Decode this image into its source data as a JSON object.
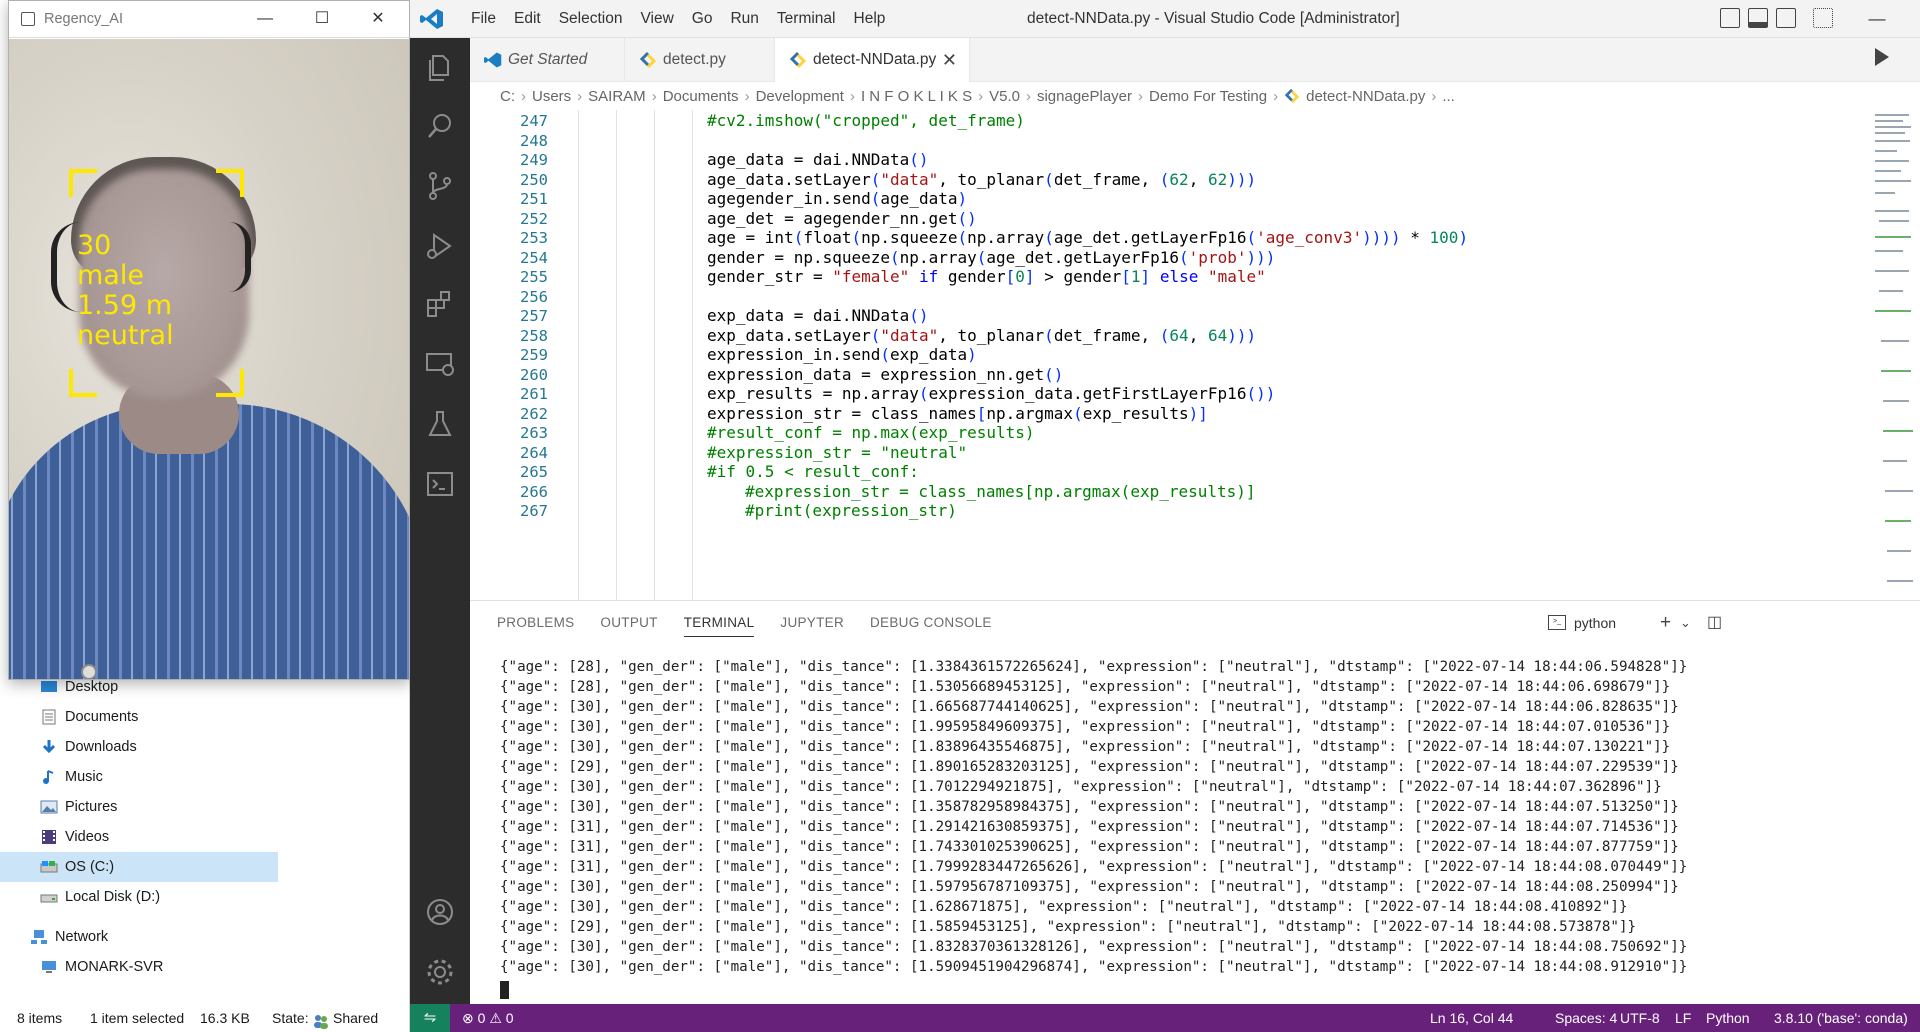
{
  "explorer": {
    "tree": [
      {
        "label": "Desktop",
        "icon": "desktop-icon"
      },
      {
        "label": "Documents",
        "icon": "documents-icon"
      },
      {
        "label": "Downloads",
        "icon": "downloads-icon"
      },
      {
        "label": "Music",
        "icon": "music-icon"
      },
      {
        "label": "Pictures",
        "icon": "pictures-icon"
      },
      {
        "label": "Videos",
        "icon": "videos-icon"
      },
      {
        "label": "OS (C:)",
        "icon": "drive-icon"
      },
      {
        "label": "Local Disk (D:)",
        "icon": "drive-icon"
      },
      {
        "label": "Network",
        "icon": "network-icon"
      },
      {
        "label": "MONARK-SVR",
        "icon": "computer-icon"
      }
    ],
    "status": {
      "items": "8 items",
      "selected": "1 item selected",
      "size": "16.3 KB",
      "state_label": "State:",
      "state_value": "Shared"
    }
  },
  "camera": {
    "title": "Regency_AI",
    "labels": [
      "30",
      "male",
      "1.59  m",
      "neutral"
    ]
  },
  "vscode": {
    "menu": [
      "File",
      "Edit",
      "Selection",
      "View",
      "Go",
      "Run",
      "Terminal",
      "Help"
    ],
    "window_title": "detect-NNData.py - Visual Studio Code [Administrator]",
    "tabs": [
      {
        "label": "Get Started"
      },
      {
        "label": "detect.py"
      },
      {
        "label": "detect-NNData.py"
      }
    ],
    "breadcrumb": [
      "C:",
      "Users",
      "SAIRAM",
      "Documents",
      "Development",
      "I N F O K L I K S",
      "V5.0",
      "signagePlayer",
      "Demo For Testing",
      "detect-NNData.py",
      "..."
    ],
    "line_numbers": [
      "247",
      "248",
      "249",
      "250",
      "251",
      "252",
      "253",
      "254",
      "255",
      "256",
      "257",
      "258",
      "259",
      "260",
      "261",
      "262",
      "263",
      "264",
      "265",
      "266",
      "267"
    ],
    "panel_tabs": [
      "PROBLEMS",
      "OUTPUT",
      "TERMINAL",
      "JUPYTER",
      "DEBUG CONSOLE"
    ],
    "terminal_name": "python",
    "terminal_lines": [
      "{\"age\": [28], \"gen_der\": [\"male\"], \"dis_tance\": [1.3384361572265624], \"expression\": [\"neutral\"], \"dtstamp\": [\"2022-07-14 18:44:06.594828\"]}",
      "{\"age\": [28], \"gen_der\": [\"male\"], \"dis_tance\": [1.53056689453125], \"expression\": [\"neutral\"], \"dtstamp\": [\"2022-07-14 18:44:06.698679\"]}",
      "{\"age\": [30], \"gen_der\": [\"male\"], \"dis_tance\": [1.665687744140625], \"expression\": [\"neutral\"], \"dtstamp\": [\"2022-07-14 18:44:06.828635\"]}",
      "{\"age\": [30], \"gen_der\": [\"male\"], \"dis_tance\": [1.99595849609375], \"expression\": [\"neutral\"], \"dtstamp\": [\"2022-07-14 18:44:07.010536\"]}",
      "{\"age\": [30], \"gen_der\": [\"male\"], \"dis_tance\": [1.83896435546875], \"expression\": [\"neutral\"], \"dtstamp\": [\"2022-07-14 18:44:07.130221\"]}",
      "{\"age\": [29], \"gen_der\": [\"male\"], \"dis_tance\": [1.890165283203125], \"expression\": [\"neutral\"], \"dtstamp\": [\"2022-07-14 18:44:07.229539\"]}",
      "{\"age\": [30], \"gen_der\": [\"male\"], \"dis_tance\": [1.7012294921875], \"expression\": [\"neutral\"], \"dtstamp\": [\"2022-07-14 18:44:07.362896\"]}",
      "{\"age\": [30], \"gen_der\": [\"male\"], \"dis_tance\": [1.358782958984375], \"expression\": [\"neutral\"], \"dtstamp\": [\"2022-07-14 18:44:07.513250\"]}",
      "{\"age\": [31], \"gen_der\": [\"male\"], \"dis_tance\": [1.291421630859375], \"expression\": [\"neutral\"], \"dtstamp\": [\"2022-07-14 18:44:07.714536\"]}",
      "{\"age\": [31], \"gen_der\": [\"male\"], \"dis_tance\": [1.743301025390625], \"expression\": [\"neutral\"], \"dtstamp\": [\"2022-07-14 18:44:07.877759\"]}",
      "{\"age\": [31], \"gen_der\": [\"male\"], \"dis_tance\": [1.7999283447265626], \"expression\": [\"neutral\"], \"dtstamp\": [\"2022-07-14 18:44:08.070449\"]}",
      "{\"age\": [30], \"gen_der\": [\"male\"], \"dis_tance\": [1.597956787109375], \"expression\": [\"neutral\"], \"dtstamp\": [\"2022-07-14 18:44:08.250994\"]}",
      "{\"age\": [30], \"gen_der\": [\"male\"], \"dis_tance\": [1.628671875], \"expression\": [\"neutral\"], \"dtstamp\": [\"2022-07-14 18:44:08.410892\"]}",
      "{\"age\": [29], \"gen_der\": [\"male\"], \"dis_tance\": [1.5859453125], \"expression\": [\"neutral\"], \"dtstamp\": [\"2022-07-14 18:44:08.573878\"]}",
      "{\"age\": [30], \"gen_der\": [\"male\"], \"dis_tance\": [1.8328370361328126], \"expression\": [\"neutral\"], \"dtstamp\": [\"2022-07-14 18:44:08.750692\"]}",
      "{\"age\": [30], \"gen_der\": [\"male\"], \"dis_tance\": [1.5909451904296874], \"expression\": [\"neutral\"], \"dtstamp\": [\"2022-07-14 18:44:08.912910\"]}"
    ],
    "status": {
      "errors": "0",
      "warnings": "0",
      "position": "Ln 16, Col 44",
      "spaces": "Spaces: 4",
      "encoding": "UTF-8",
      "eol": "LF",
      "language": "Python",
      "interpreter": "3.8.10 ('base': conda)"
    },
    "colors": {
      "status_bar": "#68217a",
      "remote": "#16825d",
      "activity_bar": "#2c2c2c"
    }
  }
}
